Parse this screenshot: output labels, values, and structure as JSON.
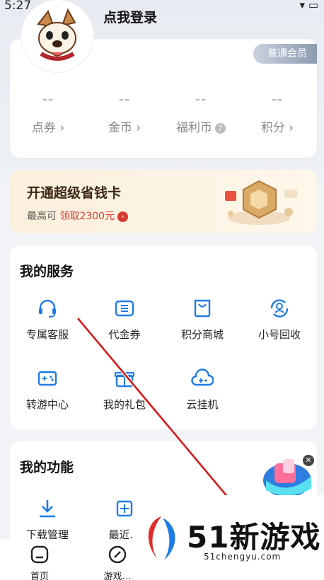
{
  "status_bar": {
    "time": "5:27"
  },
  "profile": {
    "login_label": "点我登录",
    "member_badge": "普通会员",
    "stats": [
      {
        "value": "--",
        "label": "点券"
      },
      {
        "value": "--",
        "label": "金币"
      },
      {
        "value": "--",
        "label": "福利币"
      },
      {
        "value": "--",
        "label": "积分"
      }
    ]
  },
  "promo": {
    "title": "开通超级省钱卡",
    "sub_prefix": "最高可",
    "sub_link": "领取2300元"
  },
  "services": {
    "title": "我的服务",
    "items": [
      {
        "label": "专属客服",
        "icon": "headset-icon"
      },
      {
        "label": "代金券",
        "icon": "voucher-icon"
      },
      {
        "label": "积分商城",
        "icon": "shopping-bag-icon"
      },
      {
        "label": "小号回收",
        "icon": "user-recycle-icon"
      },
      {
        "label": "转游中心",
        "icon": "gamepad-transfer-icon"
      },
      {
        "label": "我的礼包",
        "icon": "gift-icon"
      },
      {
        "label": "云挂机",
        "icon": "cloud-gamepad-icon"
      }
    ]
  },
  "functions": {
    "title": "我的功能",
    "items": [
      {
        "label": "下载管理",
        "icon": "download-icon"
      },
      {
        "label": "最近…",
        "icon": "recent-icon"
      }
    ]
  },
  "tabbar": {
    "items": [
      {
        "label": "首页",
        "icon": "home-icon"
      },
      {
        "label": "游戏…",
        "icon": "game-icon"
      }
    ]
  },
  "watermark": {
    "brand": "51新游戏",
    "url": "51chengyu.com"
  },
  "colors": {
    "accent": "#1e7ce6",
    "promo_red": "#d93a2b"
  }
}
